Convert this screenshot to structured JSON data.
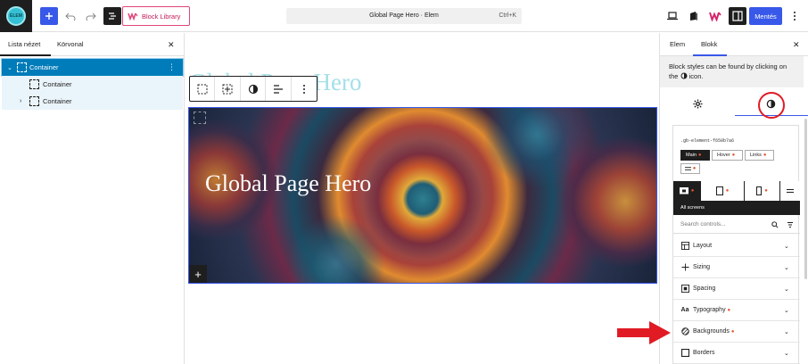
{
  "topbar": {
    "block_library_label": "Block Library",
    "command_title": "Global Page Hero · Elem",
    "command_shortcut": "Ctrl+K",
    "save_label": "Mentés",
    "accent_color": "#3858e9",
    "icons": {
      "add": "plus-icon",
      "undo": "undo-icon",
      "redo": "redo-icon",
      "list_view": "list-view-icon",
      "preview": "laptop-icon",
      "publish": "publish-icon",
      "woo": "woo-icon",
      "settings": "sidebar-toggle-icon",
      "more": "kebab-icon"
    }
  },
  "listview": {
    "tabs": [
      {
        "label": "Lista nézet"
      },
      {
        "label": "Körvonal"
      }
    ],
    "rows": [
      {
        "label": "Container",
        "selected": true
      },
      {
        "label": "Container"
      },
      {
        "label": "Container"
      }
    ]
  },
  "canvas": {
    "ghost_title": "Global Page Hero",
    "hero_title": "Global Page Hero"
  },
  "sidebar": {
    "tabs": [
      {
        "label": "Elem"
      },
      {
        "label": "Blokk"
      }
    ],
    "notice_text_1": "Block styles can be found by clicking on",
    "notice_text_2": "the",
    "notice_text_3": "icon.",
    "selector": ".gb-element-f650b7a6",
    "states": [
      "Main",
      "Hover",
      "Links"
    ],
    "all_screens": "All screens",
    "search_placeholder": "Search controls...",
    "sections": [
      {
        "label": "Layout",
        "icon": "layout-icon",
        "modified": false
      },
      {
        "label": "Sizing",
        "icon": "sizing-icon",
        "modified": false
      },
      {
        "label": "Spacing",
        "icon": "spacing-icon",
        "modified": false
      },
      {
        "label": "Typography",
        "icon": "typography-icon",
        "modified": true
      },
      {
        "label": "Backgrounds",
        "icon": "backgrounds-icon",
        "modified": true
      },
      {
        "label": "Borders",
        "icon": "borders-icon",
        "modified": false
      }
    ],
    "modified_color": "#e4572e",
    "highlight_color": "#e01b24"
  }
}
